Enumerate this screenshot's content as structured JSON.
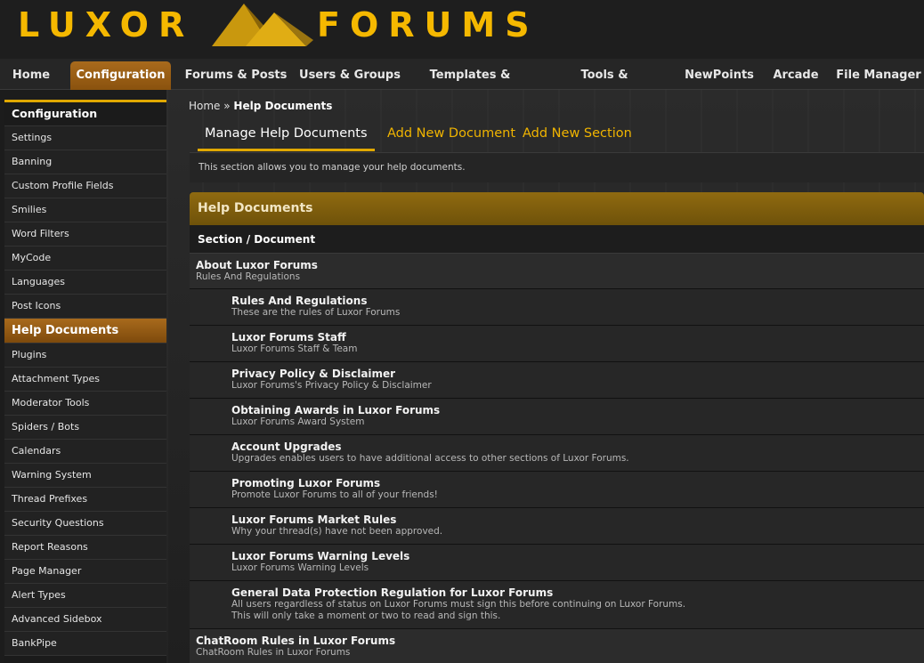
{
  "logo": {
    "left": "LUXOR",
    "right": "FORUMS"
  },
  "nav": {
    "tabs": [
      {
        "label": "Home"
      },
      {
        "label": "Configuration"
      },
      {
        "label": "Forums & Posts"
      },
      {
        "label": "Users & Groups"
      },
      {
        "label": "Templates & Style"
      },
      {
        "label": "Tools & Maintenance"
      },
      {
        "label": "NewPoints"
      },
      {
        "label": "Arcade"
      },
      {
        "label": "File Manager"
      }
    ]
  },
  "sidebar": {
    "heading": "Configuration",
    "items": [
      "Settings",
      "Banning",
      "Custom Profile Fields",
      "Smilies",
      "Word Filters",
      "MyCode",
      "Languages",
      "Post Icons"
    ],
    "active": "Help Documents",
    "items_after": [
      "Plugins",
      "Attachment Types",
      "Moderator Tools",
      "Spiders / Bots",
      "Calendars",
      "Warning System",
      "Thread Prefixes",
      "Security Questions",
      "Report Reasons",
      "Page Manager",
      "Alert Types",
      "Advanced Sidebox",
      "BankPipe"
    ]
  },
  "breadcrumb": {
    "home": "Home",
    "sep": " » ",
    "current": "Help Documents"
  },
  "subtabs": {
    "manage": "Manage Help Documents",
    "add_document": "Add New Document",
    "add_section": "Add New Section"
  },
  "description": "This section allows you to manage your help documents.",
  "table": {
    "title": "Help Documents",
    "column": "Section / Document",
    "rows": [
      {
        "kind": "section",
        "title": "About Luxor Forums",
        "sub": "Rules And Regulations"
      },
      {
        "kind": "doc",
        "title": "Rules And Regulations",
        "sub": "These are the rules of Luxor Forums"
      },
      {
        "kind": "doc",
        "title": "Luxor Forums Staff",
        "sub": "Luxor Forums Staff & Team"
      },
      {
        "kind": "doc",
        "title": "Privacy Policy & Disclaimer",
        "sub": "Luxor Forums's Privacy Policy & Disclaimer"
      },
      {
        "kind": "doc",
        "title": "Obtaining Awards in Luxor Forums",
        "sub": "Luxor Forums Award System"
      },
      {
        "kind": "doc",
        "title": "Account Upgrades",
        "sub": "Upgrades enables users to have additional access to other sections of Luxor Forums."
      },
      {
        "kind": "doc",
        "title": "Promoting Luxor Forums",
        "sub": "Promote Luxor Forums to all of your friends!"
      },
      {
        "kind": "doc",
        "title": "Luxor Forums Market Rules",
        "sub": "Why your thread(s) have not been approved."
      },
      {
        "kind": "doc",
        "title": "Luxor Forums Warning Levels",
        "sub": "Luxor Forums Warning Levels"
      },
      {
        "kind": "doc",
        "title": "General Data Protection Regulation for Luxor Forums",
        "sub": "All users regardless of status on Luxor Forums must sign this before continuing on Luxor Forums.",
        "sub2": "This will only take a moment or two to read and sign this."
      },
      {
        "kind": "section",
        "title": "ChatRoom Rules in Luxor Forums",
        "sub": "ChatRoom Rules in Luxor Forums"
      }
    ]
  }
}
